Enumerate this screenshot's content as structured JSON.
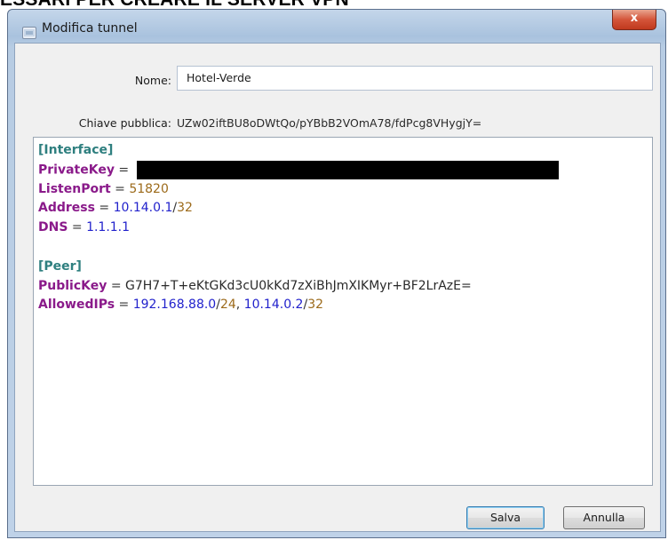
{
  "background_heading": "ESSARI PER CREARE IL SERVER VPN",
  "window": {
    "title": "Modifica tunnel",
    "close_label": "x"
  },
  "form": {
    "name_label": "Nome:",
    "name_value": "Hotel-Verde",
    "public_key_label": "Chiave pubblica:",
    "public_key_value": "UZw02iftBU8oDWtQo/pYBbB2VOmA78/fdPcg8VHygjY="
  },
  "config": {
    "interface_header": "[Interface]",
    "private_key_key": "PrivateKey",
    "equals": " = ",
    "listen_port_key": "ListenPort",
    "listen_port_value": "51820",
    "address_key": "Address",
    "address_ip": "10.14.0.1",
    "address_slash": "/",
    "address_mask": "32",
    "dns_key": "DNS",
    "dns_value": "1.1.1.1",
    "peer_header": "[Peer]",
    "peer_public_key_key": "PublicKey",
    "peer_public_key_value": "G7H7+T+eKtGKd3cU0kKd7zXiBhJmXIKMyr+BF2LrAzE=",
    "allowed_ips_key": "AllowedIPs",
    "allowed_ip1": "192.168.88.0",
    "allowed_mask1": "24",
    "separator": ", ",
    "allowed_ip2": "10.14.0.2",
    "allowed_mask2": "32"
  },
  "buttons": {
    "save_label": "Salva",
    "cancel_label": "Annulla"
  },
  "colors": {
    "section": "#2e7f7f",
    "key": "#8a1a8a",
    "ip_value": "#2222cc",
    "number_value": "#9c6a1a"
  }
}
